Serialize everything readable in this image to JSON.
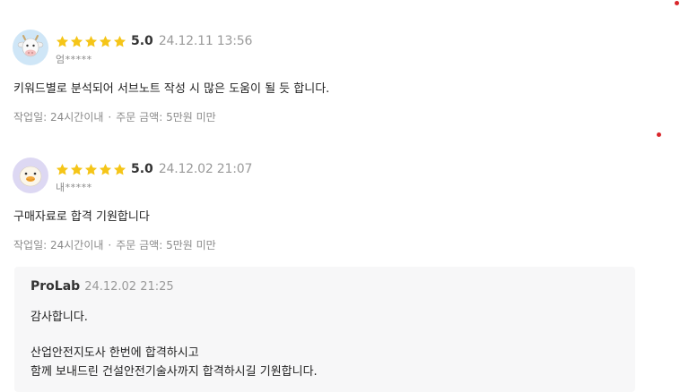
{
  "reviews": [
    {
      "avatar": "cow-avatar",
      "score": "5.0",
      "date": "24.12.11 13:56",
      "user": "엄*****",
      "text": "키워드별로 분석되어 서브노트 작성 시 많은 도움이 될 듯 합니다.",
      "work_days": "작업일: 24시간이내",
      "separator": "·",
      "order_amount": "주문 금액: 5만원 미만",
      "stars": 5
    },
    {
      "avatar": "duck-avatar",
      "score": "5.0",
      "date": "24.12.02 21:07",
      "user": "내*****",
      "text": "구매자료로 합격 기원합니다",
      "work_days": "작업일: 24시간이내",
      "separator": "·",
      "order_amount": "주문 금액: 5만원 미만",
      "stars": 5
    }
  ],
  "reply": {
    "seller": "ProLab",
    "date": "24.12.02 21:25",
    "lines": [
      "감사합니다.",
      "산업안전지도사 한번에 합격하시고",
      "함께 보내드린 건설안전기술사까지 합격하시길 기원합니다."
    ]
  },
  "colors": {
    "star": "#f5c518",
    "accent_dot": "#d9262b",
    "reply_bg": "#f7f7f8"
  }
}
